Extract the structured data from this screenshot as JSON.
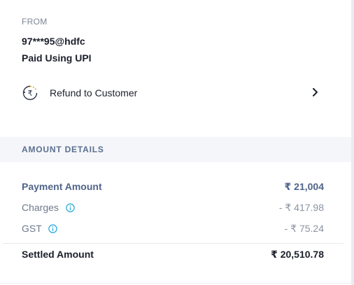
{
  "source": {
    "label": "FROM",
    "vpa": "97***95@hdfc",
    "method": "Paid Using UPI"
  },
  "refund": {
    "label": "Refund to Customer",
    "icon": "rupee-refund-icon"
  },
  "amount_details": {
    "title": "AMOUNT DETAILS",
    "rows": [
      {
        "label": "Payment Amount",
        "value": "₹ 21,004"
      },
      {
        "label": "Charges",
        "value": "- ₹ 417.98"
      },
      {
        "label": "GST",
        "value": "- ₹ 75.24"
      }
    ],
    "settled": {
      "label": "Settled Amount",
      "value": "₹ 20,510.78"
    }
  },
  "colors": {
    "accent": "#5b6f8e",
    "info_icon": "#1ea7d7",
    "section_bg": "#f4f6fa"
  }
}
